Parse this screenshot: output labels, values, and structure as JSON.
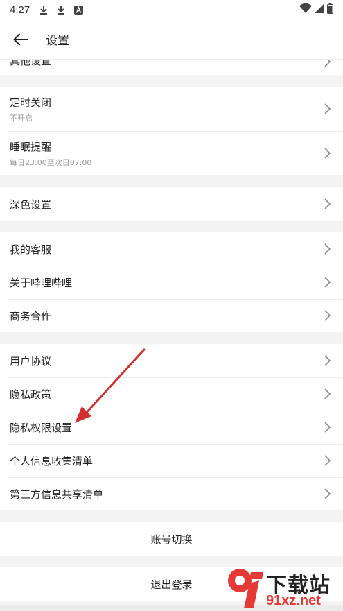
{
  "status_bar": {
    "time": "4:27",
    "icons": [
      "download-icon",
      "download-icon",
      "a-icon"
    ],
    "right_icons": [
      "wifi-icon",
      "signal-icon",
      "battery-icon"
    ]
  },
  "toolbar": {
    "title": "设置"
  },
  "partial_row": {
    "label": "其他设置"
  },
  "groups": [
    [
      {
        "label": "定时关闭",
        "sub": "不开启"
      },
      {
        "label": "睡眠提醒",
        "sub": "每日23:00至次日07:00"
      }
    ],
    [
      {
        "label": "深色设置"
      }
    ],
    [
      {
        "label": "我的客服"
      },
      {
        "label": "关于哔哩哔哩"
      },
      {
        "label": "商务合作"
      }
    ],
    [
      {
        "label": "用户协议"
      },
      {
        "label": "隐私政策"
      },
      {
        "label": "隐私权限设置"
      },
      {
        "label": "个人信息收集清单"
      },
      {
        "label": "第三方信息共享清单"
      }
    ]
  ],
  "actions": {
    "switch_account": "账号切换",
    "logout": "退出登录"
  },
  "watermark": {
    "logo_text": "9f",
    "brand": "下载站",
    "url": "91xz.net"
  },
  "colors": {
    "background": "#f4f4f4",
    "annotation_arrow": "#d32f2f",
    "watermark_red": "#e53935"
  }
}
